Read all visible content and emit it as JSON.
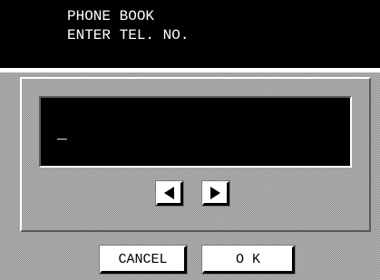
{
  "header": {
    "line1": "PHONE BOOK",
    "line2": "ENTER TEL. NO."
  },
  "display": {
    "value": "_"
  },
  "nav": {
    "left_icon": "left-triangle-icon",
    "right_icon": "right-triangle-icon"
  },
  "buttons": {
    "cancel_label": "CANCEL",
    "ok_label": "O K"
  },
  "colors": {
    "screen_background": "#000000",
    "panel_pattern": "#bdbdbd",
    "button_face": "#ffffff"
  }
}
